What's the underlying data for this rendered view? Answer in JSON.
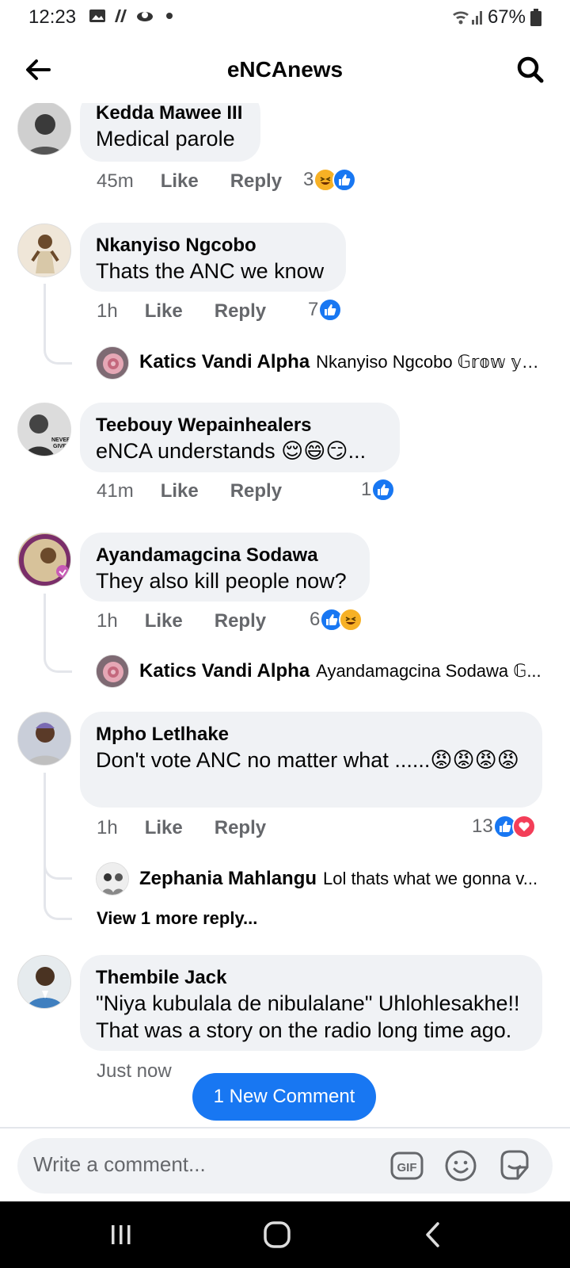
{
  "status": {
    "time": "12:23",
    "battery": "67%"
  },
  "header": {
    "title": "eNCAnews"
  },
  "comments": [
    {
      "author": "Kedda Mawee III",
      "text": "Medical parole",
      "time": "45m",
      "like": "Like",
      "reply": "Reply",
      "reaction_count": "3",
      "reactions": [
        "haha-icon",
        "like-icon"
      ]
    },
    {
      "author": "Nkanyiso Ngcobo",
      "text": "Thats the ANC we know",
      "time": "1h",
      "like": "Like",
      "reply": "Reply",
      "reaction_count": "7",
      "reactions": [
        "like-icon"
      ],
      "replies": [
        {
          "author": "Katics Vandi Alpha",
          "text": "Nkanyiso Ngcobo 𝔾𝕣𝕠𝕨 𝕪𝕠..."
        }
      ]
    },
    {
      "author": "Teebouy Wepainhealers",
      "text": "eNCA understands 😌😄😏...",
      "time": "41m",
      "like": "Like",
      "reply": "Reply",
      "reaction_count": "1",
      "reactions": [
        "like-icon"
      ]
    },
    {
      "author": "Ayandamagcina Sodawa",
      "text": "They also kill people now?",
      "time": "1h",
      "like": "Like",
      "reply": "Reply",
      "reaction_count": "6",
      "reactions": [
        "like-icon",
        "haha-icon"
      ],
      "replies": [
        {
          "author": "Katics Vandi Alpha",
          "text": "Ayandamagcina Sodawa 𝔾..."
        }
      ]
    },
    {
      "author": "Mpho Letlhake",
      "text": "Don't vote ANC no matter what ......😡😡😡😡",
      "time": "1h",
      "like": "Like",
      "reply": "Reply",
      "reaction_count": "13",
      "reactions": [
        "like-icon",
        "love-icon"
      ],
      "replies": [
        {
          "author": "Zephania Mahlangu",
          "text": "Lol thats what we gonna v..."
        }
      ],
      "view_more": "View 1 more reply..."
    },
    {
      "author": "Thembile Jack",
      "text": "\"Niya kubulala de nibulalane\" Uhlohlesakhe!! That was a story on the radio long time ago.",
      "time": "Just now"
    }
  ],
  "new_comment_button": "1 New Comment",
  "composer": {
    "placeholder": "Write a comment..."
  },
  "colors": {
    "accent": "#1877f2",
    "bubble": "#f0f2f5",
    "muted": "#65676b"
  }
}
